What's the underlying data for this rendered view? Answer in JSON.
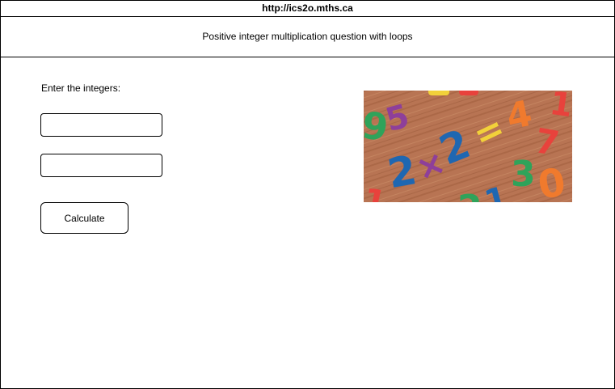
{
  "browser": {
    "url": "http://ics2o.mths.ca"
  },
  "header": {
    "title": "Positive integer multiplication question with loops"
  },
  "form": {
    "prompt": "Enter the integers:",
    "first_integer_value": "",
    "second_integer_value": "",
    "calculate_label": "Calculate"
  },
  "image": {
    "subject": "colorful-plastic-numbers-on-wood",
    "glyphs": [
      "9",
      "5",
      "2",
      "×",
      "2",
      "=",
      "4",
      "7",
      "1",
      "3",
      "0",
      "2",
      "1",
      "1"
    ],
    "colors": {
      "wood": "#b87453",
      "red": "#e8423c",
      "purple": "#8e3f9a",
      "blue": "#1f67b1",
      "green": "#2fa35a",
      "yellow": "#f2d13a",
      "orange": "#f07a2d"
    }
  }
}
